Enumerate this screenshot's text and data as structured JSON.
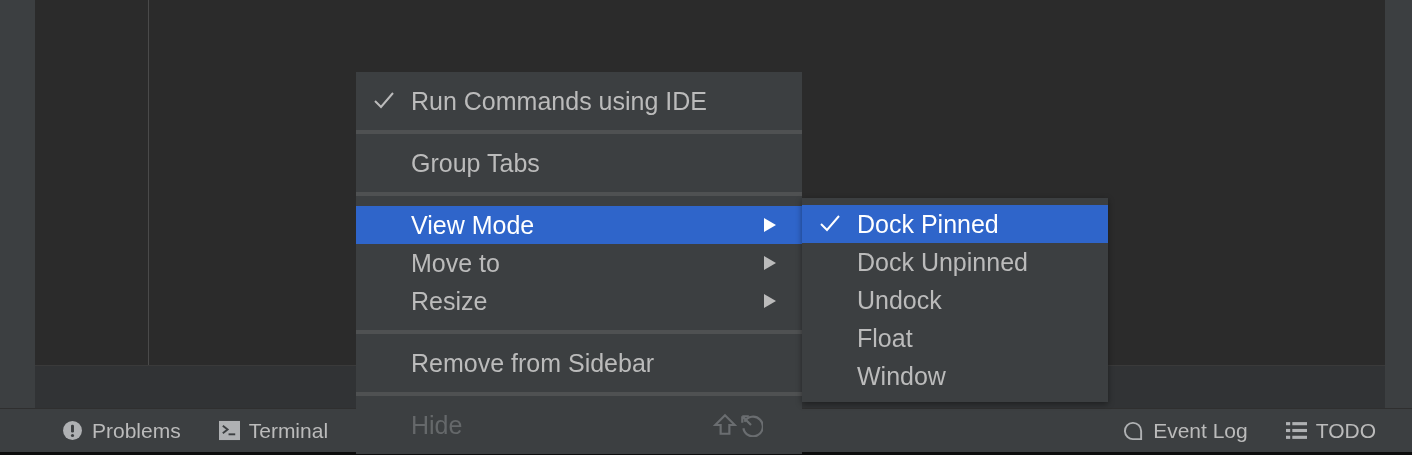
{
  "status_bar": {
    "left": [
      {
        "label": "Problems"
      },
      {
        "label": "Terminal"
      }
    ],
    "right": [
      {
        "label": "Event Log"
      },
      {
        "label": "TODO"
      }
    ]
  },
  "context_menu": {
    "sections": [
      [
        {
          "kind": "plain",
          "label": "Run Commands using IDE",
          "checked": true,
          "selected": false,
          "disabled": false
        }
      ],
      [
        {
          "kind": "plain",
          "label": "Group Tabs",
          "checked": false,
          "selected": false,
          "disabled": false
        }
      ],
      [
        {
          "kind": "submenu",
          "label": "View Mode",
          "checked": false,
          "selected": true,
          "disabled": false
        },
        {
          "kind": "submenu",
          "label": "Move to",
          "checked": false,
          "selected": false,
          "disabled": false
        },
        {
          "kind": "submenu",
          "label": "Resize",
          "checked": false,
          "selected": false,
          "disabled": false
        }
      ],
      [
        {
          "kind": "plain",
          "label": "Remove from Sidebar",
          "checked": false,
          "selected": false,
          "disabled": false
        }
      ],
      [
        {
          "kind": "shortcut",
          "label": "Hide",
          "checked": false,
          "selected": false,
          "disabled": true
        }
      ]
    ]
  },
  "submenu": {
    "items": [
      {
        "label": "Dock Pinned",
        "checked": true,
        "selected": true
      },
      {
        "label": "Dock Unpinned",
        "checked": false,
        "selected": false
      },
      {
        "label": "Undock",
        "checked": false,
        "selected": false
      },
      {
        "label": "Float",
        "checked": false,
        "selected": false
      },
      {
        "label": "Window",
        "checked": false,
        "selected": false
      }
    ]
  }
}
